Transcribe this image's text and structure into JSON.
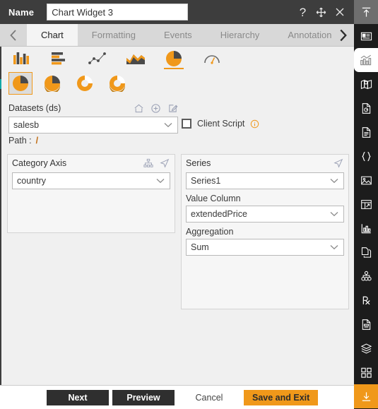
{
  "titlebar": {
    "name_label": "Name",
    "widget_name": "Chart Widget 3",
    "name_placeholder": "Chart Widget 3",
    "help_icon": "question-mark-icon",
    "move_icon": "move-arrows-icon",
    "close_icon": "close-x-icon"
  },
  "tabs": {
    "prev_arrow": "chevron-left-icon",
    "next_arrow": "chevron-right-icon",
    "items": [
      {
        "label": "Chart",
        "active": true
      },
      {
        "label": "Formatting",
        "active": false
      },
      {
        "label": "Events",
        "active": false
      },
      {
        "label": "Hierarchy",
        "active": false
      },
      {
        "label": "Annotation",
        "active": false
      }
    ]
  },
  "chart_types": {
    "primary": [
      {
        "name": "column-chart-icon",
        "selected": false
      },
      {
        "name": "bar-chart-icon",
        "selected": false
      },
      {
        "name": "line-scatter-chart-icon",
        "selected": false
      },
      {
        "name": "area-chart-icon",
        "selected": false
      },
      {
        "name": "pie-chart-icon",
        "selected": true
      },
      {
        "name": "gauge-chart-icon",
        "selected": false
      }
    ],
    "variants": [
      {
        "name": "pie-flat-icon",
        "selected": true
      },
      {
        "name": "pie-3d-icon",
        "selected": false
      },
      {
        "name": "donut-flat-icon",
        "selected": false
      },
      {
        "name": "donut-3d-icon",
        "selected": false
      }
    ]
  },
  "datasets": {
    "label": "Datasets (ds)",
    "home_icon": "home-icon",
    "add_icon": "plus-circle-icon",
    "edit_icon": "edit-pencil-icon",
    "selected": "salesb",
    "dropdown_icon": "chevron-down-icon",
    "path_label": "Path :",
    "path_value": "/"
  },
  "client_script": {
    "label": "Client Script",
    "checked": false,
    "info_icon": "info-circle-icon"
  },
  "category_axis": {
    "title": "Category Axis",
    "hierarchy_icon": "hierarchy-icon",
    "send_icon": "cursor-arrow-icon",
    "value": "country",
    "dropdown_icon": "chevron-down-icon"
  },
  "series": {
    "title": "Series",
    "send_icon": "cursor-arrow-icon",
    "series_value": "Series1",
    "value_column_label": "Value Column",
    "value_column_value": "extendedPrice",
    "aggregation_label": "Aggregation",
    "aggregation_value": "Sum",
    "dropdown_icon": "chevron-down-icon"
  },
  "footer": {
    "next": "Next",
    "preview": "Preview",
    "cancel": "Cancel",
    "save_and_exit": "Save and Exit"
  },
  "rail": {
    "collapse_icon": "collapse-up-icon",
    "items": [
      {
        "name": "widget-panel-icon",
        "active": false
      },
      {
        "name": "chart-widget-icon",
        "active": true
      },
      {
        "name": "map-widget-icon",
        "active": false
      },
      {
        "name": "dataset-file-icon",
        "active": false
      },
      {
        "name": "document-icon",
        "active": false
      },
      {
        "name": "code-braces-icon",
        "active": false
      },
      {
        "name": "image-icon",
        "active": false
      },
      {
        "name": "table-widget-icon",
        "active": false
      },
      {
        "name": "bar-stats-icon",
        "active": false
      },
      {
        "name": "copy-file-icon",
        "active": false
      },
      {
        "name": "cluster-icon",
        "active": false
      },
      {
        "name": "prescription-rx-icon",
        "active": false
      },
      {
        "name": "report-doc-icon",
        "active": false
      },
      {
        "name": "layers-icon",
        "active": false
      },
      {
        "name": "grid-blocks-icon",
        "active": false
      },
      {
        "name": "download-icon",
        "active": true
      }
    ]
  },
  "colors": {
    "accent": "#f0981a",
    "titlebar": "#3d3d3d",
    "rail": "#1c1c1c",
    "panel_bg": "#f6f6f6",
    "content_bg": "#f0f0f0",
    "teal_mark": "#11a8a8"
  }
}
